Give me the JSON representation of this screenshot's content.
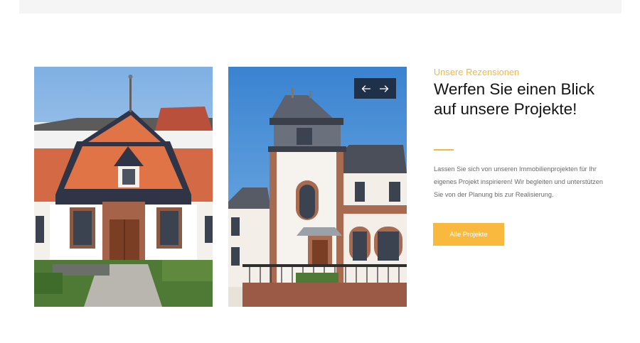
{
  "section": {
    "eyebrow": "Unsere Rezensionen",
    "title": "Werfen Sie einen Blick auf unsere Projekte!",
    "description": "Lassen Sie sich von unseren Immobilienprojekten für Ihr eigenes Projekt inspirieren! Wir begleiten und unterstützen Sie von der Planung bis zur Realisierung.",
    "cta_label": "Alle Projekte"
  },
  "slider": {
    "prev_icon": "arrow-left-icon",
    "next_icon": "arrow-right-icon"
  },
  "colors": {
    "accent": "#f4b73d",
    "button": "#f9b93f",
    "nav_background": "#1f3049",
    "heading": "#141414",
    "body_text": "#6a6a6a"
  }
}
